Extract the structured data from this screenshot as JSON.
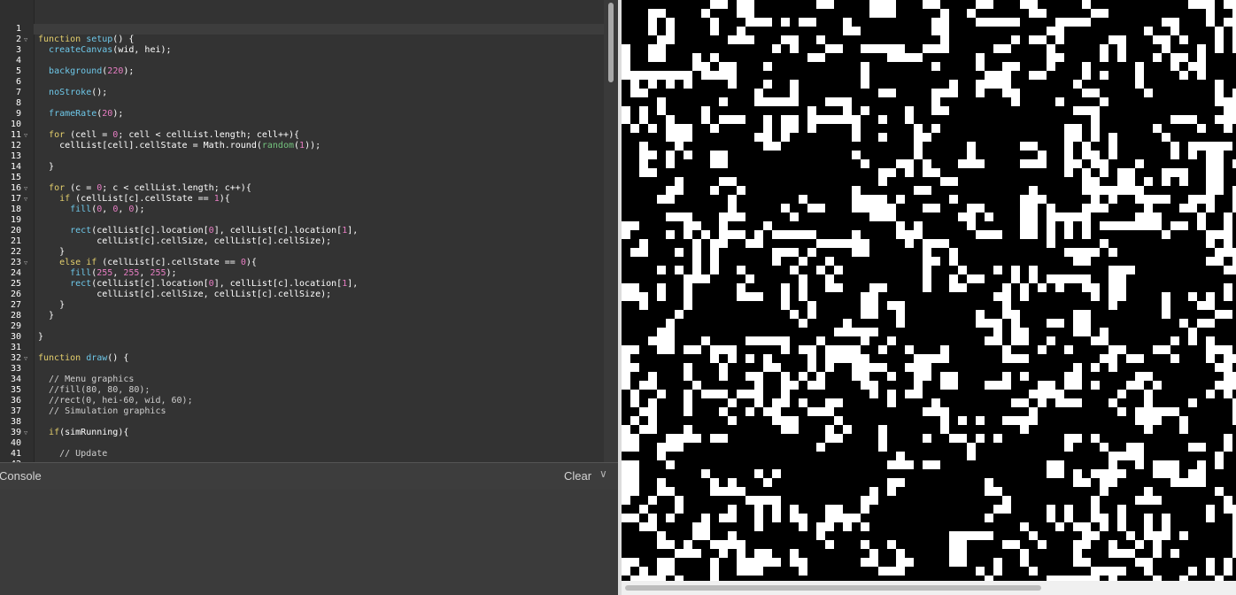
{
  "editor": {
    "lines": [
      [],
      [
        [
          "kw",
          "function "
        ],
        [
          "fn",
          "setup"
        ],
        [
          "t",
          "() {"
        ]
      ],
      [
        [
          "t",
          "  "
        ],
        [
          "fn",
          "createCanvas"
        ],
        [
          "t",
          "(wid, hei);"
        ]
      ],
      [],
      [
        [
          "t",
          "  "
        ],
        [
          "fn",
          "background"
        ],
        [
          "t",
          "("
        ],
        [
          "num",
          "220"
        ],
        [
          "t",
          ");"
        ]
      ],
      [],
      [
        [
          "t",
          "  "
        ],
        [
          "fn",
          "noStroke"
        ],
        [
          "t",
          "();"
        ]
      ],
      [],
      [
        [
          "t",
          "  "
        ],
        [
          "fn",
          "frameRate"
        ],
        [
          "t",
          "("
        ],
        [
          "num",
          "20"
        ],
        [
          "t",
          ");"
        ]
      ],
      [],
      [
        [
          "t",
          "  "
        ],
        [
          "kw",
          "for"
        ],
        [
          "t",
          " (cell = "
        ],
        [
          "num",
          "0"
        ],
        [
          "t",
          "; cell < cellList.length; cell++){"
        ]
      ],
      [
        [
          "t",
          "    cellList[cell].cellState = Math.round("
        ],
        [
          "fn2",
          "random"
        ],
        [
          "t",
          "("
        ],
        [
          "num",
          "1"
        ],
        [
          "t",
          "));"
        ]
      ],
      [],
      [
        [
          "t",
          "  }"
        ]
      ],
      [],
      [
        [
          "t",
          "  "
        ],
        [
          "kw",
          "for"
        ],
        [
          "t",
          " (c = "
        ],
        [
          "num",
          "0"
        ],
        [
          "t",
          "; c < cellList.length; c++){"
        ]
      ],
      [
        [
          "t",
          "    "
        ],
        [
          "kw",
          "if"
        ],
        [
          "t",
          " (cellList[c].cellState == "
        ],
        [
          "num",
          "1"
        ],
        [
          "t",
          "){"
        ]
      ],
      [
        [
          "t",
          "      "
        ],
        [
          "fn",
          "fill"
        ],
        [
          "t",
          "("
        ],
        [
          "num",
          "0"
        ],
        [
          "t",
          ", "
        ],
        [
          "num",
          "0"
        ],
        [
          "t",
          ", "
        ],
        [
          "num",
          "0"
        ],
        [
          "t",
          ");"
        ]
      ],
      [],
      [
        [
          "t",
          "      "
        ],
        [
          "fn",
          "rect"
        ],
        [
          "t",
          "(cellList[c].location["
        ],
        [
          "num",
          "0"
        ],
        [
          "t",
          "], cellList[c].location["
        ],
        [
          "num",
          "1"
        ],
        [
          "t",
          "],"
        ]
      ],
      [
        [
          "t",
          "           cellList[c].cellSize, cellList[c].cellSize);"
        ]
      ],
      [
        [
          "t",
          "    }"
        ]
      ],
      [
        [
          "t",
          "    "
        ],
        [
          "kw",
          "else if"
        ],
        [
          "t",
          " (cellList[c].cellState == "
        ],
        [
          "num",
          "0"
        ],
        [
          "t",
          "){"
        ]
      ],
      [
        [
          "t",
          "      "
        ],
        [
          "fn",
          "fill"
        ],
        [
          "t",
          "("
        ],
        [
          "num",
          "255"
        ],
        [
          "t",
          ", "
        ],
        [
          "num",
          "255"
        ],
        [
          "t",
          ", "
        ],
        [
          "num",
          "255"
        ],
        [
          "t",
          ");"
        ]
      ],
      [
        [
          "t",
          "      "
        ],
        [
          "fn",
          "rect"
        ],
        [
          "t",
          "(cellList[c].location["
        ],
        [
          "num",
          "0"
        ],
        [
          "t",
          "], cellList[c].location["
        ],
        [
          "num",
          "1"
        ],
        [
          "t",
          "],"
        ]
      ],
      [
        [
          "t",
          "           cellList[c].cellSize, cellList[c].cellSize);"
        ]
      ],
      [
        [
          "t",
          "    }"
        ]
      ],
      [
        [
          "t",
          "  }"
        ]
      ],
      [],
      [
        [
          "t",
          "}"
        ]
      ],
      [],
      [
        [
          "kw",
          "function "
        ],
        [
          "fn",
          "draw"
        ],
        [
          "t",
          "() {"
        ]
      ],
      [],
      [
        [
          "cm",
          "  // Menu graphics"
        ]
      ],
      [
        [
          "cm",
          "  //fill(80, 80, 80);"
        ]
      ],
      [
        [
          "cm",
          "  //rect(0, hei-60, wid, 60);"
        ]
      ],
      [
        [
          "cm",
          "  // Simulation graphics"
        ]
      ],
      [],
      [
        [
          "t",
          "  "
        ],
        [
          "kw",
          "if"
        ],
        [
          "t",
          "(simRunning){"
        ]
      ],
      [],
      [
        [
          "cm",
          "    // Update"
        ]
      ],
      [
        [
          "t",
          "    "
        ]
      ]
    ],
    "fold_lines": [
      2,
      11,
      16,
      17,
      23,
      32,
      39
    ],
    "colors": {
      "keyword": "#e4cf6c",
      "function": "#6ec7e8",
      "builtin": "#74c37e",
      "number": "#e87ec4",
      "comment": "#cfcfcf"
    }
  },
  "console": {
    "title": "Console",
    "clear_label": "Clear",
    "chevron": "chevron-down-icon"
  },
  "preview": {
    "cell_color_alive": "#ffffff",
    "cell_color_dead": "#000000",
    "seed": 7341
  }
}
